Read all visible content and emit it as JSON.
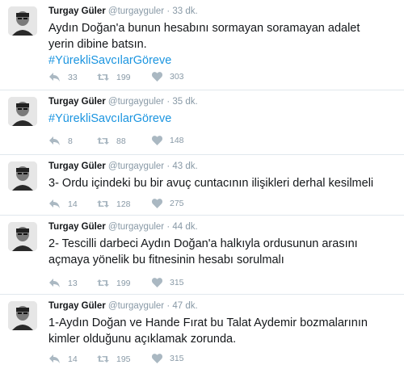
{
  "tweets": [
    {
      "name": "Turgay Güler",
      "handle": "@turgayguler",
      "time": "· 33 dk.",
      "text": "Aydın Doğan'a bunun hesabını sormayan soramayan adalet yerin dibine batsın.",
      "hashtag": "#YürekliSavcılarGöreve",
      "replies": "33",
      "retweets": "199",
      "likes": "303"
    },
    {
      "name": "Turgay Güler",
      "handle": "@turgayguler",
      "time": "· 35 dk.",
      "text": "",
      "hashtag": "#YürekliSavcılarGöreve",
      "replies": "8",
      "retweets": "88",
      "likes": "148"
    },
    {
      "name": "Turgay Güler",
      "handle": "@turgayguler",
      "time": "· 43 dk.",
      "text": "3- Ordu içindeki bu bir avuç cuntacının ilişikleri derhal kesilmeli",
      "hashtag": "",
      "replies": "14",
      "retweets": "128",
      "likes": "275"
    },
    {
      "name": "Turgay Güler",
      "handle": "@turgayguler",
      "time": "· 44 dk.",
      "text": "2- Tescilli darbeci Aydın Doğan'a halkıyla ordusunun arasını açmaya yönelik bu fitnesinin hesabı sorulmalı",
      "hashtag": "",
      "replies": "13",
      "retweets": "199",
      "likes": "315"
    },
    {
      "name": "Turgay Güler",
      "handle": "@turgayguler",
      "time": "· 47 dk.",
      "text": "1-Aydın Doğan ve Hande Fırat bu Talat Aydemir bozmalarının kimler olduğunu açıklamak zorunda.",
      "hashtag": "",
      "replies": "14",
      "retweets": "195",
      "likes": "315"
    }
  ],
  "icons": {
    "reply": "reply-icon",
    "retweet": "retweet-icon",
    "like": "heart-icon",
    "avatar": "avatar"
  },
  "colors": {
    "hashtag": "#1b95e0",
    "meta": "#8899a6",
    "icon": "#aab8c2"
  }
}
